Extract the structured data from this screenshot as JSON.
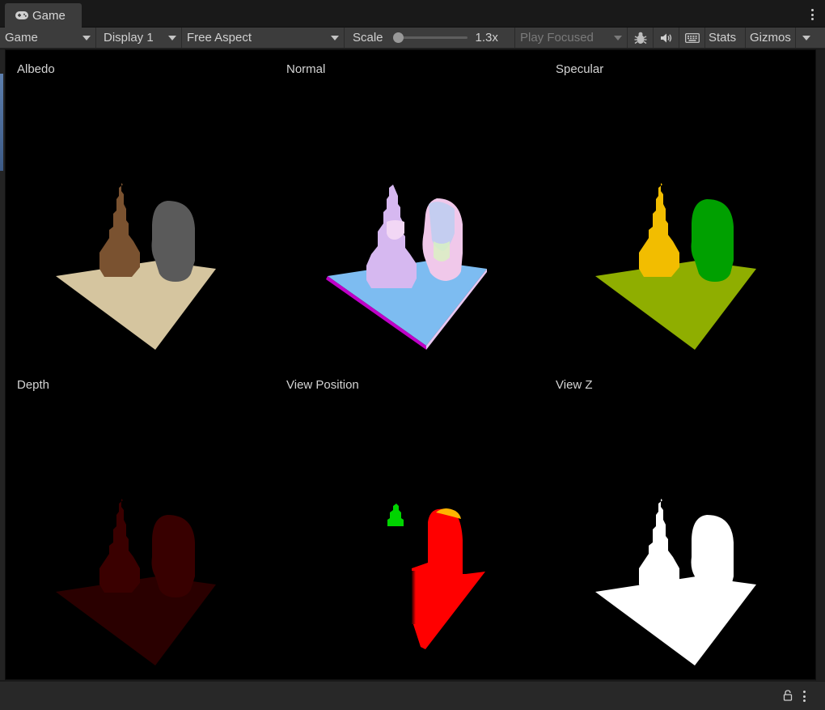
{
  "tab": {
    "label": "Game",
    "icon": "gamepad-icon"
  },
  "toolbar": {
    "game_dropdown": "Game",
    "display_dropdown": "Display 1",
    "aspect_dropdown": "Free Aspect",
    "scale_label": "Scale",
    "scale_value": "1.3x",
    "play_focused": "Play Focused",
    "stats_label": "Stats",
    "gizmos_label": "Gizmos"
  },
  "views": [
    {
      "label": "Albedo"
    },
    {
      "label": "Normal"
    },
    {
      "label": "Specular"
    },
    {
      "label": "Depth"
    },
    {
      "label": "View Position"
    },
    {
      "label": "View Z"
    }
  ],
  "colors": {
    "albedo_plane": "#d5c59f",
    "albedo_buddha": "#7a5230",
    "albedo_bust": "#5a5a5a",
    "normal_plane": "#7dbcf1",
    "normal_edge": "#c000c8",
    "specular_plane": "#8fae00",
    "specular_buddha": "#f2bd00",
    "specular_bust": "#00a000",
    "depth_color": "#3a0000",
    "viewpos_red": "#ff0000",
    "viewpos_green": "#00ff00",
    "viewz_white": "#ffffff"
  }
}
